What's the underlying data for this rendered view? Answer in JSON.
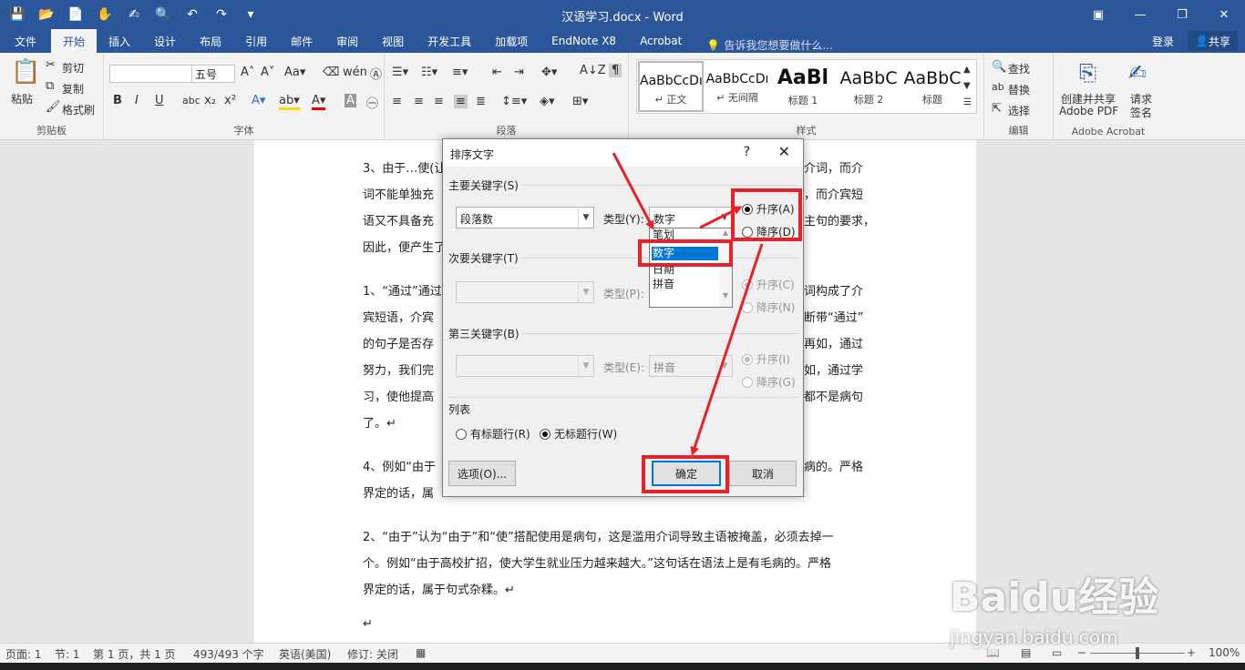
{
  "window": {
    "title": "汉语学习.docx - Word"
  },
  "qat": [
    "💾",
    "📂",
    "📄",
    "✋",
    "✍",
    "🔍",
    "↶",
    "↷",
    "▾"
  ],
  "wincontrols": [
    "▣",
    "—",
    "❐",
    "✕"
  ],
  "tabs": [
    "文件",
    "开始",
    "插入",
    "设计",
    "布局",
    "引用",
    "邮件",
    "审阅",
    "视图",
    "开发工具",
    "加载项",
    "EndNote X8",
    "Acrobat"
  ],
  "tellme": "告诉我您想要做什么...",
  "login": "登录",
  "share": "共享",
  "ribbon": {
    "clipboard": {
      "label": "剪贴板",
      "paste": "粘贴",
      "cut": "剪切",
      "copy": "复制",
      "format_painter": "格式刷"
    },
    "font": {
      "label": "字体",
      "font_name": "",
      "font_size": "五号"
    },
    "paragraph": {
      "label": "段落"
    },
    "styles": {
      "label": "样式",
      "items": [
        {
          "preview": "AaBbCcDı",
          "name": "↵ 正文"
        },
        {
          "preview": "AaBbCcDı",
          "name": "↵ 无间隔"
        },
        {
          "preview": "AaBl",
          "name": "标题 1"
        },
        {
          "preview": "AaBbC",
          "name": "标题 2"
        },
        {
          "preview": "AaBbC",
          "name": "标题"
        }
      ]
    },
    "editing": {
      "label": "编辑",
      "find": "查找",
      "replace": "替换",
      "select": "选择"
    },
    "acrobat": {
      "label": "Adobe Acrobat",
      "create": "创建并共享",
      "create2": "Adobe PDF",
      "sign": "请求",
      "sign2": "签名"
    }
  },
  "doc_lines": [
    "3、由于…使(让",
    "词不能单独充",
    "语又不具备充",
    "因此，便产生了",
    "1、“通过”通过",
    "宾短语，介宾",
    "的句子是否存",
    "努力，我们完",
    "习，使他提高",
    "了。↵",
    "4、例如“由于",
    "界定的话，属",
    "2、“由于”认为“由于”和“使”搭配使用是病句，这是滥用介词导致主语被掩盖，必须去掉一",
    "个。例如“由于高校扩招，使大学生就业压力越来越大。”这句话在语法上是有毛病的。严格",
    "界定的话，属于句式杂糅。↵",
    "↵"
  ],
  "doc_right": [
    "介词，而介",
    "，而介宾短",
    "主句的要求，",
    "词构成了介",
    "断带“通过”",
    "再如，通过",
    "如，通过学",
    "都不是病句",
    "病的。严格"
  ],
  "dialog": {
    "title": "排序文字",
    "help": "?",
    "close": "✕",
    "primary_label": "主要关键字(S)",
    "primary_value": "段落数",
    "type_label_y": "类型(Y):",
    "type_value": "数字",
    "asc_a": "升序(A)",
    "desc_d": "降序(D)",
    "secondary_label": "次要关键字(T)",
    "type_label_p": "类型(P):",
    "asc_c": "升序(C)",
    "desc_n": "降序(N)",
    "third_label": "第三关键字(B)",
    "type_label_e": "类型(E):",
    "type_value_e": "拼音",
    "asc_i": "升序(I)",
    "desc_g": "降序(G)",
    "list_label": "列表",
    "has_header": "有标题行(R)",
    "no_header": "无标题行(W)",
    "options": "选项(O)...",
    "ok": "确定",
    "cancel": "取消"
  },
  "dropdown": [
    "笔划",
    "数字",
    "日期",
    "拼音"
  ],
  "status": {
    "page": "页面: 1",
    "section": "节: 1",
    "pages": "第 1 页，共 1 页",
    "words": "493/493 个字",
    "lang": "英语(美国)",
    "track": "修订: 关闭",
    "zoom": "100%"
  },
  "watermark": {
    "brand": "Baidu经验",
    "url": "jingyan.baidu.com"
  }
}
